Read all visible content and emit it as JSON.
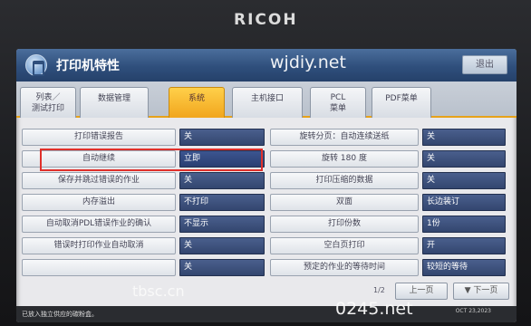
{
  "brand": "RICOH",
  "title": "打印机特性",
  "exit_label": "退出",
  "watermarks": {
    "top": "wjdiy.net",
    "bottom_left": "tbsc.cn",
    "bottom_right": "0245.net"
  },
  "tabs": [
    {
      "label_line1": "列表／",
      "label_line2": "测试打印",
      "active": false
    },
    {
      "label_line1": "数据管理",
      "label_line2": "",
      "active": false
    },
    {
      "label_line1": "系统",
      "label_line2": "",
      "active": true
    },
    {
      "label_line1": "主机接口",
      "label_line2": "",
      "active": false
    },
    {
      "label_line1": "PCL",
      "label_line2": "菜单",
      "active": false
    },
    {
      "label_line1": "PDF菜单",
      "label_line2": "",
      "active": false
    }
  ],
  "left_settings": [
    {
      "label": "打印错误报告",
      "value": "关"
    },
    {
      "label": "自动继续",
      "value": "立即"
    },
    {
      "label": "保存并跳过错误的作业",
      "value": "关"
    },
    {
      "label": "内存溢出",
      "value": "不打印"
    },
    {
      "label": "自动取消PDL错误作业的确认",
      "value": "不显示"
    },
    {
      "label": "错误时打印作业自动取消",
      "value": "关"
    },
    {
      "label": "",
      "value": "关"
    }
  ],
  "right_settings": [
    {
      "label": "旋转分页：自动连续送纸",
      "value": "关"
    },
    {
      "label": "旋转 180 度",
      "value": "关"
    },
    {
      "label": "打印压缩的数据",
      "value": "关"
    },
    {
      "label": "双面",
      "value": "长边装订"
    },
    {
      "label": "打印份数",
      "value": "1份"
    },
    {
      "label": "空白页打印",
      "value": "开"
    },
    {
      "label": "预定的作业的等待时间",
      "value": "较短的等待"
    }
  ],
  "pagination": {
    "page": "1/2",
    "prev_label": "上一页",
    "next_label": "▼ 下一页"
  },
  "status_text": "已放入独立供应的碳粉盒。",
  "date_text": "OCT 23,2023"
}
